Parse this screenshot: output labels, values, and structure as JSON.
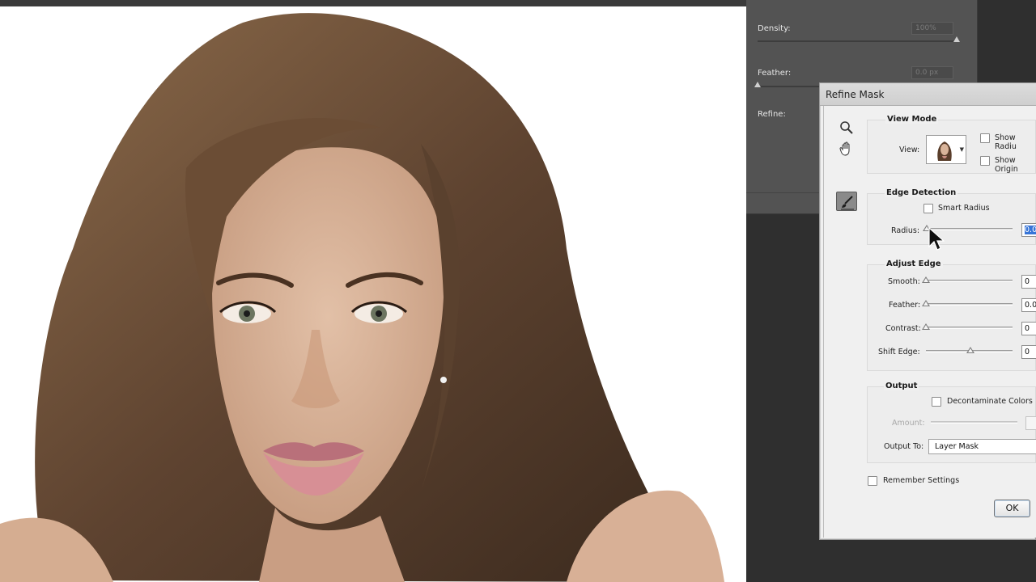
{
  "masks_panel": {
    "density_label": "Density:",
    "density_value": "100%",
    "density_level_percent": 100,
    "feather_label": "Feather:",
    "feather_value": "0.0 px",
    "feather_level_percent": 0,
    "refine_label": "Refine:"
  },
  "dialog": {
    "title": "Refine Mask",
    "view_mode": {
      "title": "View Mode",
      "view_label": "View:",
      "show_radius": "Show Radiu",
      "show_original": "Show Origin"
    },
    "edge_detection": {
      "title": "Edge Detection",
      "smart_radius": "Smart Radius",
      "radius_label": "Radius:",
      "radius_value": "0.0",
      "radius_level_percent": 0
    },
    "adjust_edge": {
      "title": "Adjust Edge",
      "smooth_label": "Smooth:",
      "smooth_value": "0",
      "feather_label": "Feather:",
      "feather_value": "0.0",
      "contrast_label": "Contrast:",
      "contrast_value": "0",
      "shift_edge_label": "Shift Edge:",
      "shift_edge_value": "0",
      "shift_edge_level_percent": 50
    },
    "output": {
      "title": "Output",
      "decontaminate": "Decontaminate Colors",
      "amount_label": "Amount:",
      "output_to_label": "Output To:",
      "output_to_value": "Layer Mask"
    },
    "remember_settings": "Remember Settings",
    "ok_label": "OK"
  },
  "icons": {
    "zoom": "zoom-icon",
    "hand": "hand-icon",
    "refine_brush": "refine-radius-brush-icon"
  },
  "colors": {
    "workspace": "#2f2f2f",
    "panel": "#535353",
    "dialog": "#f0f0f0",
    "selection": "#3875d7"
  }
}
